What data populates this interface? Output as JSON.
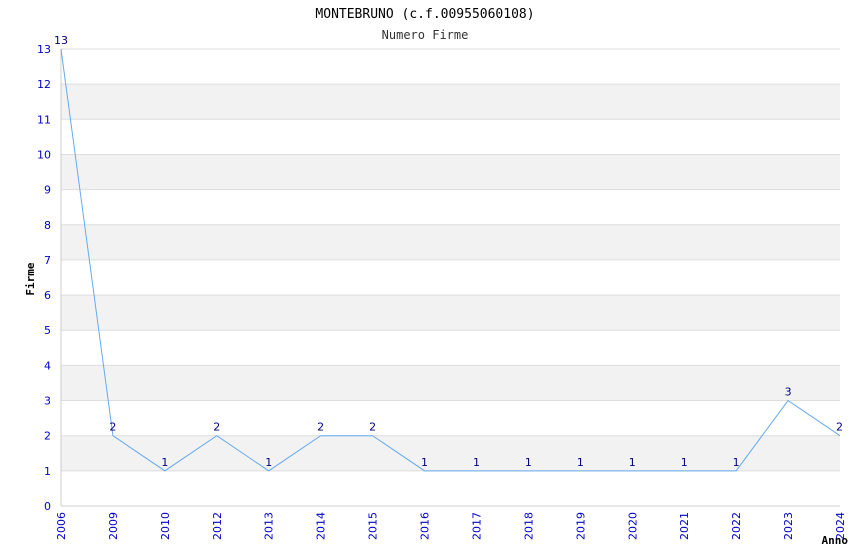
{
  "chart_data": {
    "type": "line",
    "title": "MONTEBRUNO (c.f.00955060108)",
    "subtitle": "Numero Firme",
    "xlabel": "Anno",
    "ylabel": "Firme",
    "x": [
      "2006",
      "2009",
      "2010",
      "2012",
      "2013",
      "2014",
      "2015",
      "2016",
      "2017",
      "2018",
      "2019",
      "2020",
      "2021",
      "2022",
      "2023",
      "2024"
    ],
    "values": [
      13,
      2,
      1,
      2,
      1,
      2,
      2,
      1,
      1,
      1,
      1,
      1,
      1,
      1,
      3,
      2
    ],
    "data_labels": [
      "13",
      "2",
      "1",
      "2",
      "1",
      "2",
      "2",
      "1",
      "1",
      "1",
      "1",
      "1",
      "1",
      "1",
      "3",
      "2"
    ],
    "ylim": [
      0,
      13
    ],
    "y_ticks": [
      "0",
      "1",
      "2",
      "3",
      "4",
      "5",
      "6",
      "7",
      "8",
      "9",
      "10",
      "11",
      "12",
      "13"
    ],
    "grid": true,
    "colors": {
      "line": "#66aaee",
      "band_alt": "#f2f2f2",
      "band": "#ffffff",
      "grid": "#dddddd",
      "tick_text": "#0000cc",
      "data_label_text": "#000080"
    }
  }
}
